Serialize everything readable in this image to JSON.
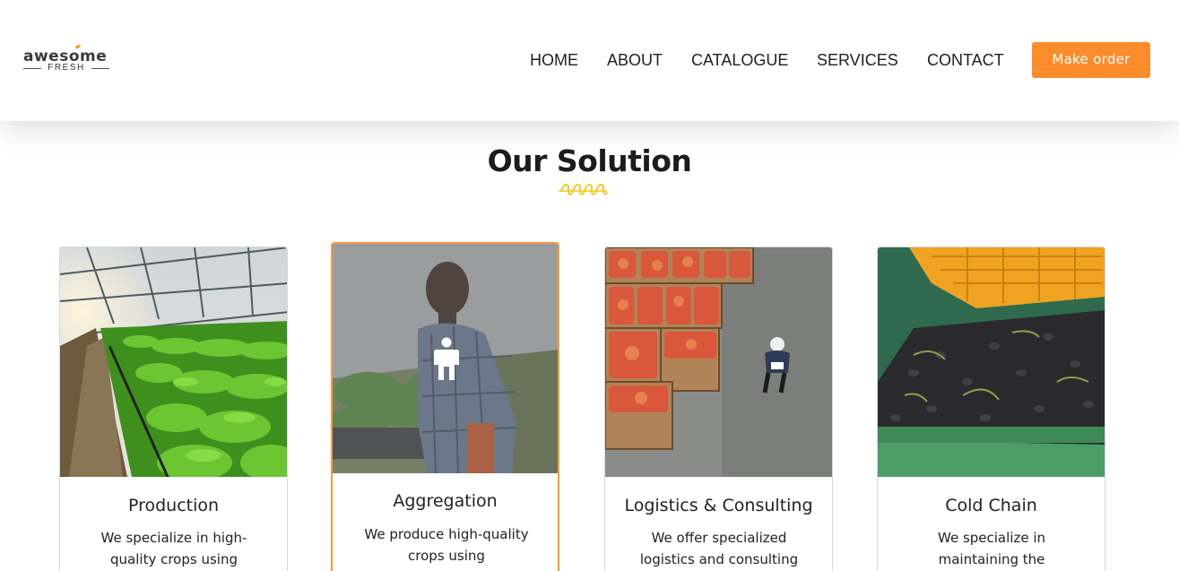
{
  "brand": {
    "name": "awesome",
    "sub": "FRESH",
    "accent": "#f6a11c"
  },
  "nav": {
    "items": [
      {
        "label": "HOME"
      },
      {
        "label": "ABOUT"
      },
      {
        "label": "CATALOGUE"
      },
      {
        "label": "SERVICES"
      },
      {
        "label": "CONTACT"
      }
    ],
    "cta_label": "Make order",
    "cta_color": "#fb8c2b"
  },
  "section": {
    "title": "Our Solution",
    "divider_color": "#f5c518"
  },
  "cards": [
    {
      "title": "Production",
      "text": "We specialize in high-quality crops using",
      "image": "greenhouse-lettuce-photo"
    },
    {
      "title": "Aggregation",
      "text": "We produce high-quality crops using",
      "image": "farmer-with-greens-photo",
      "active": true,
      "overlay_icon": "person-icon"
    },
    {
      "title": "Logistics & Consulting",
      "text": "We offer specialized logistics and consulting",
      "image": "warehouse-apple-crates-photo"
    },
    {
      "title": "Cold Chain",
      "text": "We specialize in maintaining the",
      "image": "olives-in-crate-photo"
    }
  ]
}
